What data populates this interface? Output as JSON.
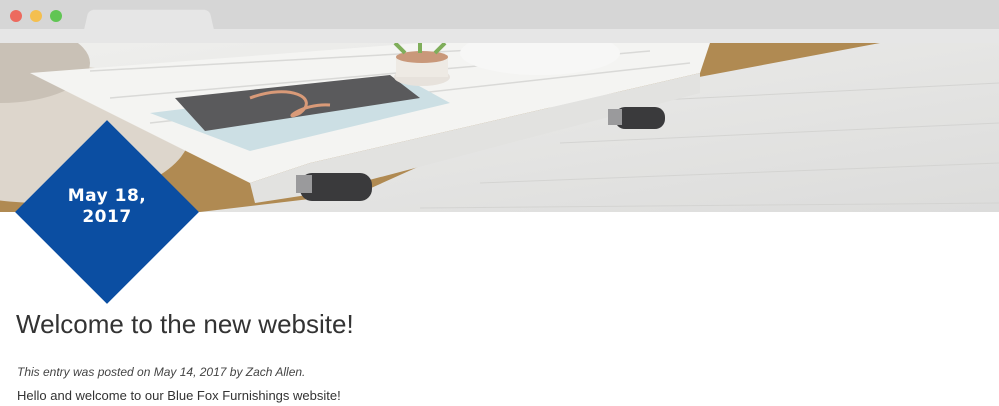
{
  "browser": {
    "window_controls": [
      "close",
      "minimize",
      "maximize"
    ]
  },
  "hero": {
    "image_alt": "white pallet coffee table with notebooks and plant"
  },
  "post": {
    "date": "May 18, 2017",
    "title": "Welcome to the new website!",
    "meta": "This entry was posted on May 14, 2017 by Zach Allen.",
    "body": "Hello and welcome to our Blue Fox Furnishings website!"
  },
  "colors": {
    "accent": "#0b4ea2",
    "title_text": "#333333"
  }
}
